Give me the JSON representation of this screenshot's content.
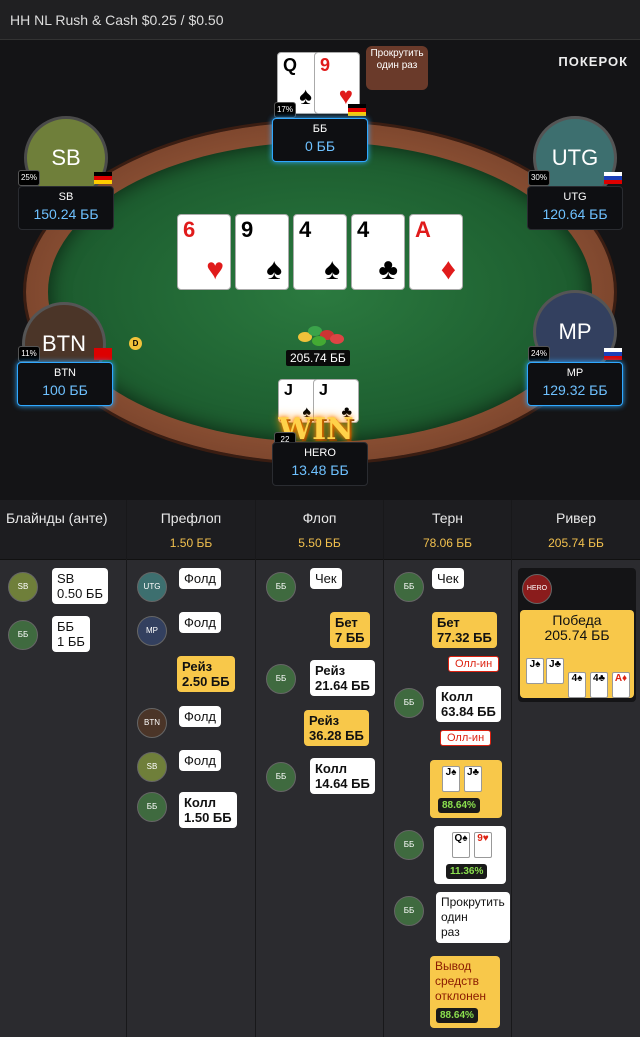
{
  "title": "HH NL Rush & Cash $0.25 / $0.50",
  "logo": "ПОКЕРОК",
  "bubble": "Прокрутить один раз",
  "pot": "205.74 ББ",
  "win_text": "WIN",
  "dealer": "D",
  "board": [
    {
      "rank": "6",
      "suit": "♥",
      "red": true
    },
    {
      "rank": "9",
      "suit": "♠",
      "red": false
    },
    {
      "rank": "4",
      "suit": "♠",
      "red": false
    },
    {
      "rank": "4",
      "suit": "♣",
      "red": false
    },
    {
      "rank": "A",
      "suit": "♦",
      "red": true
    }
  ],
  "players": {
    "bb": {
      "name": "ББ",
      "stack": "0 ББ",
      "pct": "17%",
      "cards": [
        {
          "rank": "Q",
          "suit": "♠"
        },
        {
          "rank": "9",
          "suit": "♥"
        }
      ]
    },
    "sb": {
      "avatar": "SB",
      "name": "SB",
      "stack": "150.24 ББ",
      "pct": "25%"
    },
    "utg": {
      "avatar": "UTG",
      "name": "UTG",
      "stack": "120.64 ББ",
      "pct": "30%"
    },
    "btn": {
      "avatar": "BTN",
      "name": "BTN",
      "stack": "100 ББ",
      "pct": "11%"
    },
    "mp": {
      "avatar": "MP",
      "name": "MP",
      "stack": "129.32 ББ",
      "pct": "24%"
    },
    "hero": {
      "name": "HERO",
      "stack": "13.48 ББ",
      "badge": "22",
      "cards": [
        {
          "rank": "J",
          "suit": "♠"
        },
        {
          "rank": "J",
          "suit": "♣"
        }
      ]
    }
  },
  "colors": {
    "sb": "#6f7f3a",
    "utg": "#3d6f6f",
    "btn": "#4b3528",
    "mp": "#33405f",
    "bb": "#3f6a3f",
    "accent": "#2fa8ff",
    "gold": "#f2c14e"
  },
  "history": {
    "headers": [
      {
        "title": "Блайнды (анте)",
        "pot": ""
      },
      {
        "title": "Префлоп",
        "pot": "1.50 ББ"
      },
      {
        "title": "Флоп",
        "pot": "5.50 ББ"
      },
      {
        "title": "Терн",
        "pot": "78.06 ББ"
      },
      {
        "title": "Ривер",
        "pot": "205.74 ББ"
      }
    ],
    "blinds": [
      {
        "pos": "SB",
        "line1": "SB",
        "line2": "0.50 ББ"
      },
      {
        "pos": "ББ",
        "line1": "ББ",
        "line2": "1 ББ"
      }
    ],
    "preflop": [
      {
        "pos": "UTG",
        "action": "Фолд"
      },
      {
        "pos": "MP",
        "action": "Фолд"
      },
      {
        "pos": "",
        "line1": "Рейз",
        "line2": "2.50 ББ"
      },
      {
        "pos": "BTN",
        "action": "Фолд"
      },
      {
        "pos": "SB",
        "action": "Фолд"
      },
      {
        "pos": "ББ",
        "line1": "Колл",
        "line2": "1.50 ББ"
      }
    ],
    "flop": [
      {
        "pos": "ББ",
        "action": "Чек"
      },
      {
        "pos": "",
        "line1": "Бет",
        "line2": "7 ББ"
      },
      {
        "pos": "ББ",
        "line1": "Рейз",
        "line2": "21.64 ББ"
      },
      {
        "pos": "",
        "line1": "Рейз",
        "line2": "36.28 ББ"
      },
      {
        "pos": "ББ",
        "line1": "Колл",
        "line2": "14.64 ББ"
      }
    ],
    "turn": [
      {
        "pos": "ББ",
        "action": "Чек"
      },
      {
        "pos": "",
        "line1": "Бет",
        "line2": "77.32 ББ",
        "allin": "Олл-ин"
      },
      {
        "pos": "ББ",
        "line1": "Колл",
        "line2": "63.84 ББ",
        "allin": "Олл-ин"
      },
      {
        "pos": "",
        "equity": "88.64%",
        "cards": [
          "J♠",
          "J♣"
        ]
      },
      {
        "pos": "ББ",
        "equity": "11.36%",
        "cards": [
          "Q♠",
          "9♥"
        ]
      },
      {
        "pos": "ББ",
        "line1": "Прокрутить",
        "line2": "один",
        "line3": "раз"
      },
      {
        "pos": "",
        "line1": "Вывод",
        "line2": "средств",
        "line3": "отклонен",
        "equity": "88.64%"
      }
    ],
    "river": {
      "pos": "HERO",
      "line1": "Победа",
      "line2": "205.74 ББ",
      "cards": [
        "J♠",
        "J♣",
        "4♠",
        "4♣",
        "A♦"
      ]
    }
  }
}
